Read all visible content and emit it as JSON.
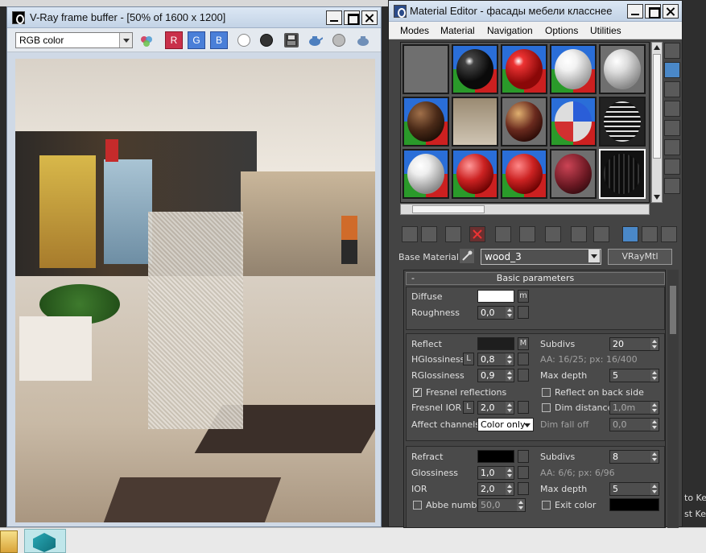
{
  "vfb": {
    "title": "V-Ray frame buffer - [50% of 1600 x 1200]",
    "channel_value": "RGB color",
    "btn_r": "R",
    "btn_g": "G",
    "btn_b": "B"
  },
  "material_editor": {
    "title": "Material Editor - фасады мебели класснее",
    "menu": [
      "Modes",
      "Material",
      "Navigation",
      "Options",
      "Utilities"
    ],
    "base_material_label": "Base Material:",
    "material_name": "wood_3",
    "material_type": "VRayMtl",
    "rollout_title": "Basic parameters",
    "rollout_toggle": "-",
    "diffuse": {
      "label": "Diffuse",
      "map": "m",
      "color": "#ffffff"
    },
    "roughness": {
      "label": "Roughness",
      "value": "0,0"
    },
    "reflect": {
      "label": "Reflect",
      "map": "M",
      "color": "#1e1e1e",
      "subdivs_label": "Subdivs",
      "subdivs": "20",
      "aa_info": "AA: 16/25; px: 16/400",
      "hgloss_label": "HGlossiness",
      "hgloss_lock": "L",
      "hgloss": "0,8",
      "rgloss_label": "RGlossiness",
      "rgloss": "0,9",
      "maxdepth_label": "Max depth",
      "maxdepth": "5",
      "fresnel_label": "Fresnel reflections",
      "fresnel_checked": "✔",
      "backside_label": "Reflect on back side",
      "fresnel_ior_label": "Fresnel IOR",
      "fresnel_ior_lock": "L",
      "fresnel_ior": "2,0",
      "dimdist_label": "Dim distance",
      "dimdist": "1,0m",
      "affect_label": "Affect channels",
      "affect_value": "Color only",
      "dimfall_label": "Dim fall off",
      "dimfall": "0,0"
    },
    "refract": {
      "label": "Refract",
      "color": "#000000",
      "subdivs_label": "Subdivs",
      "subdivs": "8",
      "aa_info": "AA: 6/6; px: 6/96",
      "gloss_label": "Glossiness",
      "gloss": "1,0",
      "ior_label": "IOR",
      "ior": "2,0",
      "maxdepth_label": "Max depth",
      "maxdepth": "5",
      "abbe_label": "Abbe number",
      "abbe": "50,0",
      "exit_label": "Exit color",
      "exit_color": "#000000"
    }
  },
  "desktop": {
    "right_edge_text_1": "to Ke",
    "right_edge_text_2": "st Ke"
  },
  "colors": {
    "accent": "#4a88c8",
    "rollout_bg": "#444444",
    "titlebar": "#c3d3e6"
  }
}
